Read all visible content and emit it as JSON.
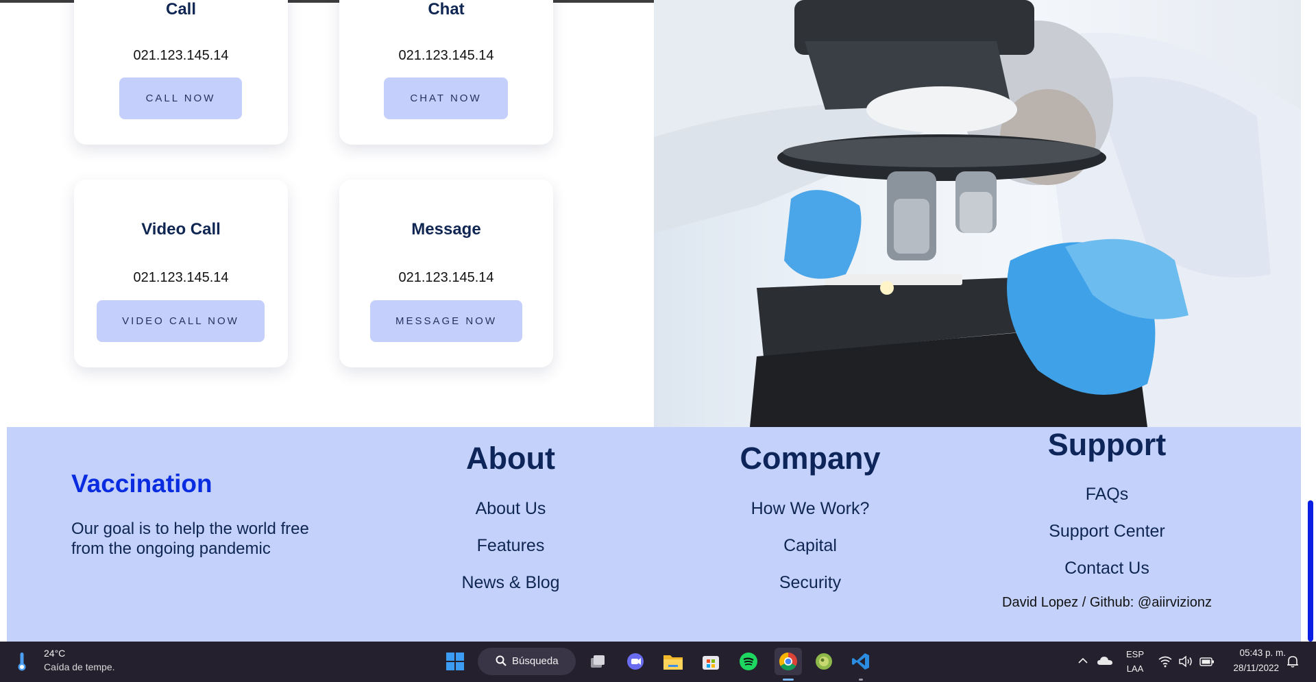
{
  "contact_cards": [
    {
      "title": "Call",
      "number": "021.123.145.14",
      "button": "CALL NOW"
    },
    {
      "title": "Chat",
      "number": "021.123.145.14",
      "button": "CHAT NOW"
    },
    {
      "title": "Video Call",
      "number": "021.123.145.14",
      "button": "VIDEO CALL NOW"
    },
    {
      "title": "Message",
      "number": "021.123.145.14",
      "button": "MESSAGE NOW"
    }
  ],
  "footer": {
    "brand": "Vaccination",
    "tagline_line1": "Our goal is to help the world free",
    "tagline_line2": "from the ongoing pandemic",
    "about": {
      "title": "About",
      "links": [
        "About Us",
        "Features",
        "News & Blog"
      ]
    },
    "company": {
      "title": "Company",
      "links": [
        "How We Work?",
        "Capital",
        "Security"
      ]
    },
    "support": {
      "title": "Support",
      "links": [
        "FAQs",
        "Support Center",
        "Contact Us"
      ]
    },
    "credit": "David Lopez / Github: @aiirvizionz"
  },
  "colors": {
    "accent_blue": "#0a2ce0",
    "footer_bg": "#c4d2fb",
    "button_bg": "#c4d0fb",
    "heading_navy": "#0d2558"
  },
  "taskbar": {
    "weather_temp": "24°C",
    "weather_desc": "Caída de tempe.",
    "search_label": "Búsqueda",
    "lang_line1": "ESP",
    "lang_line2": "LAA",
    "time": "05:43 p. m.",
    "date": "28/11/2022",
    "icons": [
      "windows-start-icon",
      "search-icon",
      "task-view-icon",
      "teams-chat-icon",
      "file-explorer-icon",
      "microsoft-store-icon",
      "spotify-icon",
      "chrome-icon",
      "game-app-icon",
      "vscode-icon"
    ]
  }
}
